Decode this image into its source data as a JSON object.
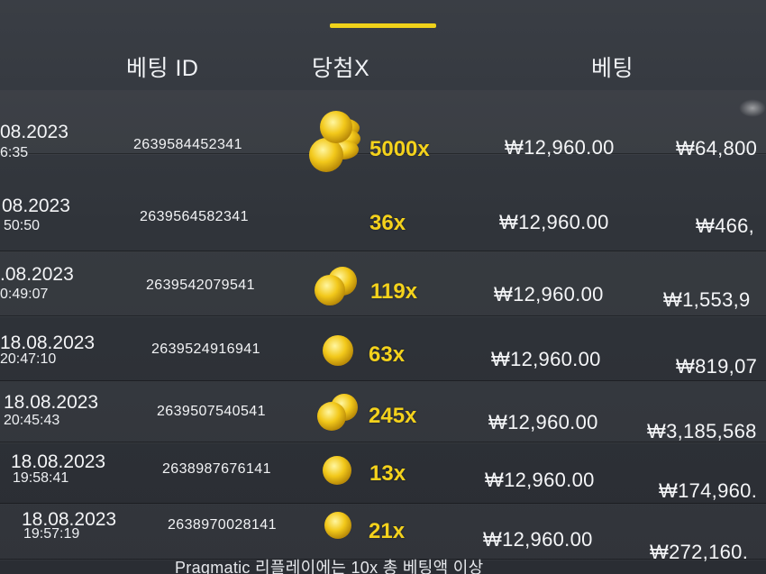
{
  "colors": {
    "accent": "#f0d21a",
    "background": "#30343a",
    "multiplier": "#f4d21c",
    "text": "#f0f2f5"
  },
  "header": {
    "bet_id": "베팅 ID",
    "win_x": "당첨X",
    "bet": "베팅"
  },
  "rows": [
    {
      "date": "08.2023",
      "time": "6:35",
      "bet_id": "2639584452341",
      "coin": "coin-stack-icon",
      "multiplier": "5000x",
      "bet": "₩12,960.00",
      "payout": "₩64,800"
    },
    {
      "date": "08.2023",
      "time": "50:50",
      "bet_id": "2639564582341",
      "coin": "coin-icon",
      "multiplier": "36x",
      "bet": "₩12,960.00",
      "payout": "₩466,"
    },
    {
      "date": ".08.2023",
      "time": "0:49:07",
      "bet_id": "2639542079541",
      "coin": "coins-icon",
      "multiplier": "119x",
      "bet": "₩12,960.00",
      "payout": "₩1,553,9"
    },
    {
      "date": "18.08.2023",
      "time": "20:47:10",
      "bet_id": "2639524916941",
      "coin": "coin-icon",
      "multiplier": "63x",
      "bet": "₩12,960.00",
      "payout": "₩819,07"
    },
    {
      "date": "18.08.2023",
      "time": "20:45:43",
      "bet_id": "2639507540541",
      "coin": "coins-icon",
      "multiplier": "245x",
      "bet": "₩12,960.00",
      "payout": "₩3,185,568"
    },
    {
      "date": "18.08.2023",
      "time": "19:58:41",
      "bet_id": "2638987676141",
      "coin": "coin-icon",
      "multiplier": "13x",
      "bet": "₩12,960.00",
      "payout": "₩174,960."
    },
    {
      "date": "18.08.2023",
      "time": "19:57:19",
      "bet_id": "2638970028141",
      "coin": "coin-icon",
      "multiplier": "21x",
      "bet": "₩12,960.00",
      "payout": "₩272,160."
    }
  ],
  "footer": {
    "note": "Pragmatic 리플레이에는 10x 총 베팅액 이상"
  }
}
